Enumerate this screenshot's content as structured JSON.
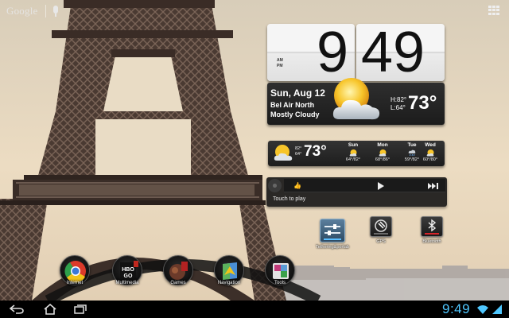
{
  "search": {
    "logo_text": "Google"
  },
  "clock": {
    "hours": "9",
    "minutes": "49",
    "ampm": "AM\nPM",
    "date": "Sun, Aug 12",
    "location": "Bel Air North",
    "condition": "Mostly Cloudy",
    "high_low": "H:82°\nL:64°",
    "temperature": "73°"
  },
  "forecast": {
    "now_high_low": "82°\n64°",
    "now_temp": "73°",
    "days": [
      {
        "name": "Sun",
        "range": "64°/82°",
        "icon": "partly-sunny-icon"
      },
      {
        "name": "Mon",
        "range": "68°/86°",
        "icon": "partly-sunny-icon"
      },
      {
        "name": "Tue",
        "range": "59°/82°",
        "icon": "rain-icon"
      },
      {
        "name": "Wed",
        "range": "60°/80°",
        "icon": "partly-sunny-icon"
      }
    ]
  },
  "music": {
    "touch_label": "Touch to play"
  },
  "toggles": [
    {
      "label": "Tethering&portab",
      "icon": "tethering-settings-icon"
    },
    {
      "label": "GPS",
      "icon": "gps-icon"
    },
    {
      "label": "Bluetooth",
      "icon": "bluetooth-icon"
    }
  ],
  "dock": [
    {
      "label": "Internet",
      "icon": "chrome-icon"
    },
    {
      "label": "Multimedia",
      "icon": "hbo-go-icon"
    },
    {
      "label": "Games",
      "icon": "games-icon"
    },
    {
      "label": "Navigation",
      "icon": "navigation-icon"
    },
    {
      "label": "Tools",
      "icon": "tools-icon"
    }
  ],
  "status_bar": {
    "time": "9:49"
  },
  "colors": {
    "accent_blue": "#4fc7ff",
    "bluetooth_red": "#d7242a"
  }
}
